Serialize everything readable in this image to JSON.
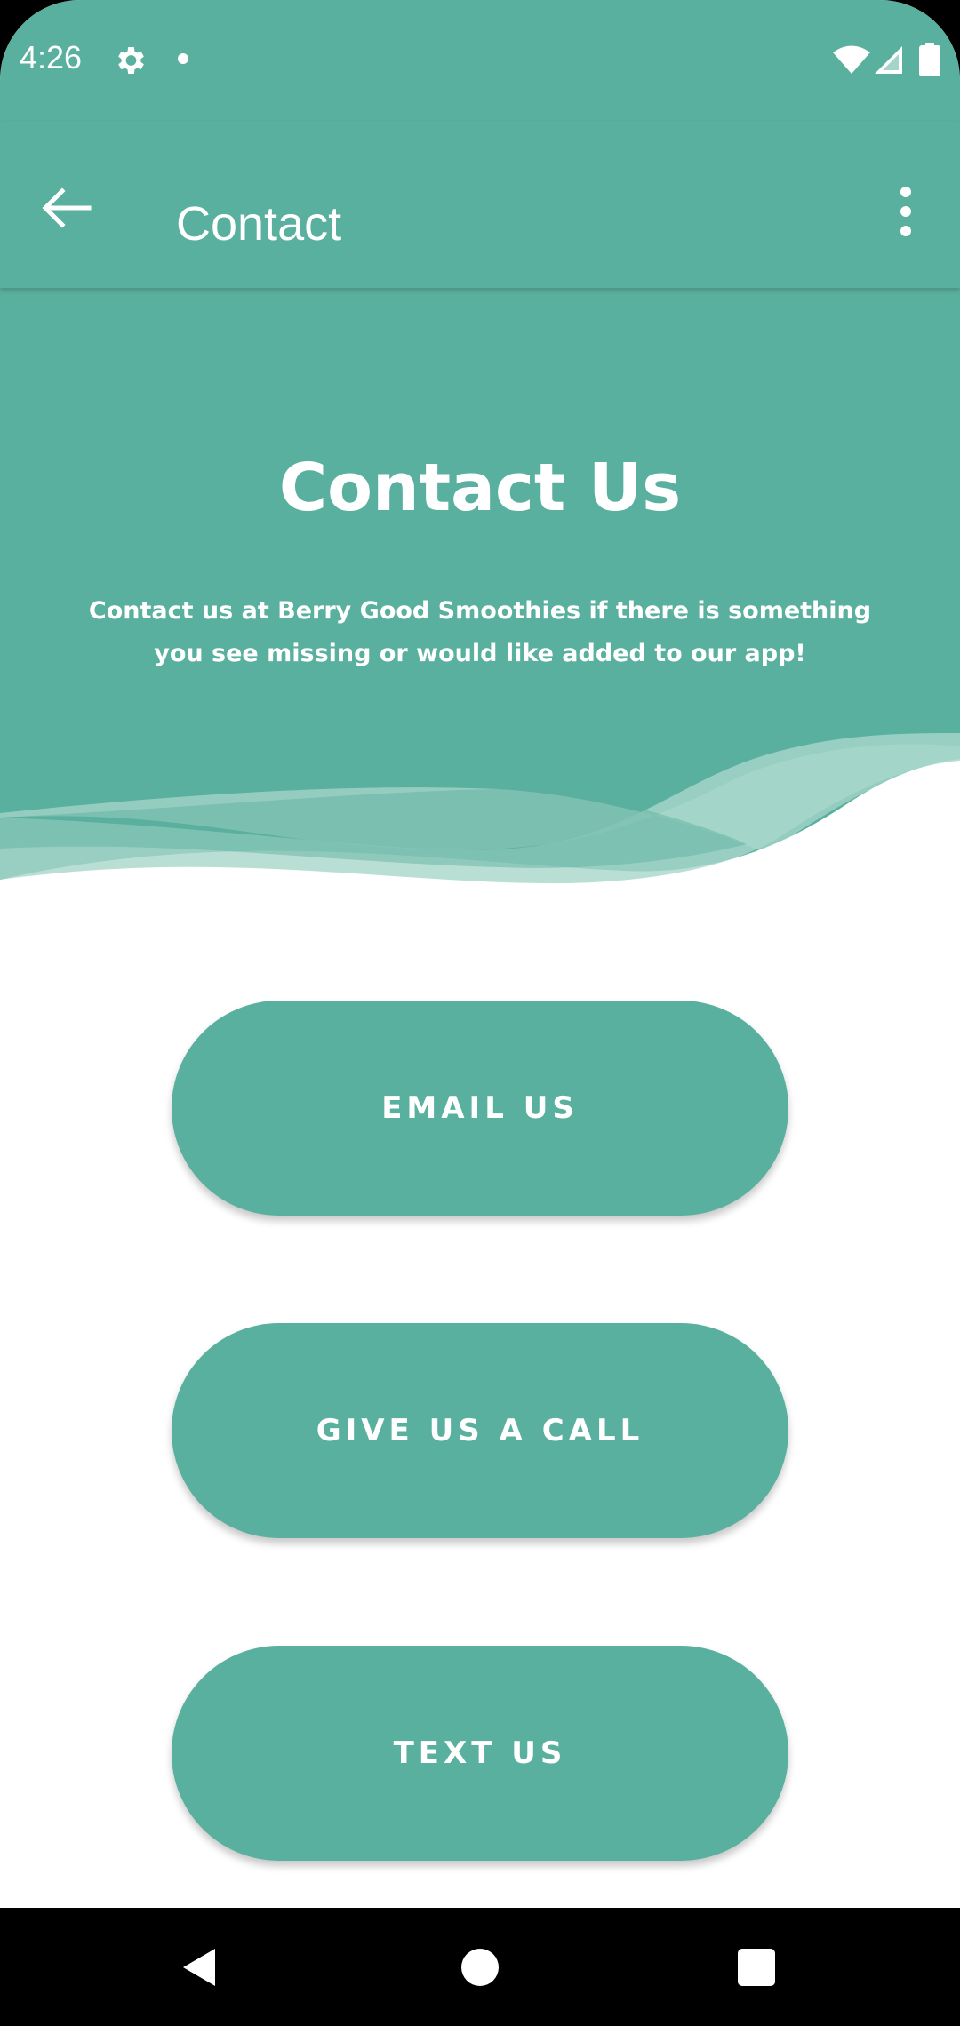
{
  "status_bar": {
    "time": "4:26",
    "icons": [
      "gear-icon",
      "notification-dot-icon",
      "wifi-icon",
      "cell-signal-icon",
      "battery-icon"
    ]
  },
  "app_bar": {
    "title": "Contact",
    "back_icon": "arrow-left-icon",
    "overflow_icon": "more-vert-icon"
  },
  "header": {
    "title": "Contact Us",
    "description": "Contact us at Berry Good Smoothies if there is something you see missing or would like added to our app!"
  },
  "buttons": {
    "email": "EMAIL US",
    "call": "GIVE US A CALL",
    "text": "TEXT US"
  },
  "nav_bar": {
    "icons": [
      "nav-back-icon",
      "nav-home-icon",
      "nav-recents-icon"
    ]
  },
  "colors": {
    "primary": "#5ab09e",
    "wave_light": "#a8d7cb",
    "background": "#ffffff",
    "nav_bar": "#000000"
  }
}
